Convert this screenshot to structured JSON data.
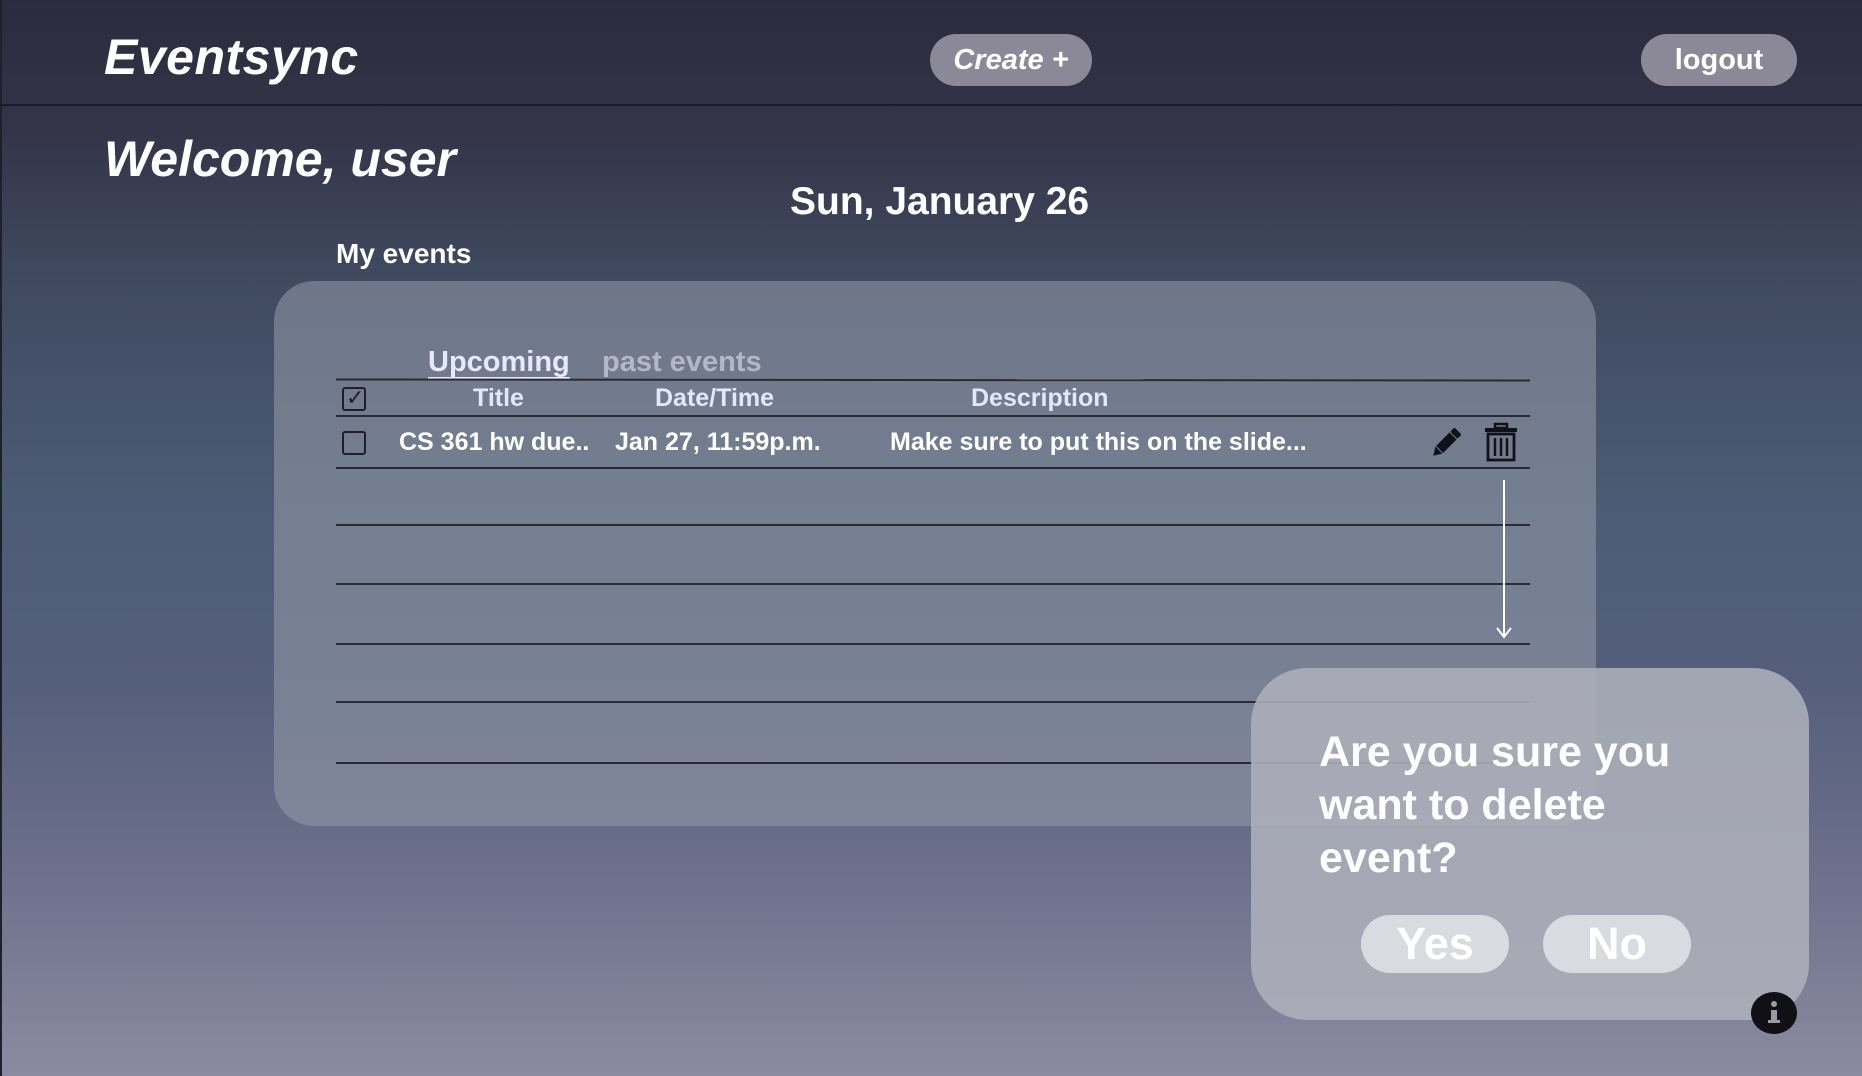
{
  "app": {
    "title": "Eventsync"
  },
  "header": {
    "create_label": "Create +",
    "logout_label": "logout"
  },
  "main": {
    "welcome": "Welcome, user",
    "date": "Sun, January 26",
    "section_label": "My events"
  },
  "tabs": [
    {
      "label": "Upcoming",
      "active": true
    },
    {
      "label": "past events",
      "active": false
    }
  ],
  "table": {
    "columns": [
      "Title",
      "Date/Time",
      "Description"
    ],
    "header_checkbox_checked": true,
    "rows": [
      {
        "checked": false,
        "title": "CS 361 hw due..",
        "datetime": "Jan 27, 11:59p.m.",
        "description": "Make sure to put this on the slide..."
      }
    ]
  },
  "row_actions": {
    "edit_icon": "pencil-icon",
    "delete_icon": "trash-icon"
  },
  "dialog": {
    "message": "Are you sure you want to delete event?",
    "yes_label": "Yes",
    "no_label": "No"
  },
  "info_icon": "info-icon",
  "colors": {
    "pill_button": "#8b8898",
    "dialog_background": "#adafba",
    "dialog_button": "#dadbe0",
    "active_tab": "#e6e8ff",
    "inactive_tab": "#b5b8c4"
  }
}
